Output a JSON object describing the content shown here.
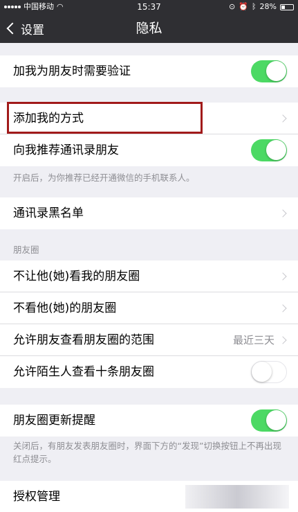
{
  "status_bar": {
    "carrier": "中国移动",
    "time": "15:37",
    "battery": "28%"
  },
  "nav": {
    "back_label": "设置",
    "title": "隐私"
  },
  "group1": {
    "verify_label": "加我为朋友时需要验证",
    "verify_on": true
  },
  "group2": {
    "add_methods_label": "添加我的方式",
    "recommend_label": "向我推荐通讯录朋友",
    "recommend_on": true,
    "footnote": "开启后，为你推荐已经开通微信的手机联系人。"
  },
  "group3": {
    "blacklist_label": "通讯录黑名单"
  },
  "moments": {
    "header": "朋友圈",
    "hide_mine_label": "不让他(她)看我的朋友圈",
    "hide_theirs_label": "不看他(她)的朋友圈",
    "range_label": "允许朋友查看朋友圈的范围",
    "range_value": "最近三天",
    "stranger_label": "允许陌生人查看十条朋友圈",
    "stranger_on": false
  },
  "group5": {
    "update_label": "朋友圈更新提醒",
    "update_on": true,
    "footnote": "关闭后，有朋友发表朋友圈时，界面下方的“发现”切换按钮上不再出现红点提示。"
  },
  "group6": {
    "auth_label": "授权管理"
  },
  "colors": {
    "toggle_on": "#4cd964",
    "highlight": "#a11a1a",
    "nav_bg": "#2f2f33"
  }
}
